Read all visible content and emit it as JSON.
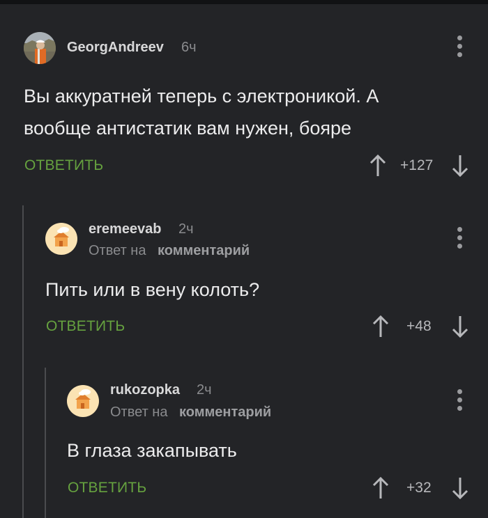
{
  "comments": [
    {
      "username": "GeorgAndreev",
      "time": "6ч",
      "text_line1": "Вы аккуратней теперь с электроникой. А",
      "text_line2": "вообще антистатик вам нужен, бояре",
      "reply_label": "ОТВЕТИТЬ",
      "rating": "+127",
      "avatar": "user-photo-avatar"
    },
    {
      "username": "eremeevab",
      "time": "2ч",
      "reply_prefix": "Ответ на",
      "reply_target": "комментарий",
      "text": "Пить или в вену колоть?",
      "reply_label": "ОТВЕТИТЬ",
      "rating": "+48",
      "avatar": "default-avatar"
    },
    {
      "username": "rukozopka",
      "time": "2ч",
      "reply_prefix": "Ответ на",
      "reply_target": "комментарий",
      "text": "В глаза закапывать",
      "reply_label": "ОТВЕТИТЬ",
      "rating": "+32",
      "avatar": "default-avatar"
    }
  ],
  "colors": {
    "background": "#232427",
    "accent_reply": "#66a23f",
    "text": "#ececed",
    "muted": "#8a8b8e"
  },
  "icons": [
    "arrow-up-icon",
    "arrow-down-icon",
    "more-vert-icon"
  ]
}
